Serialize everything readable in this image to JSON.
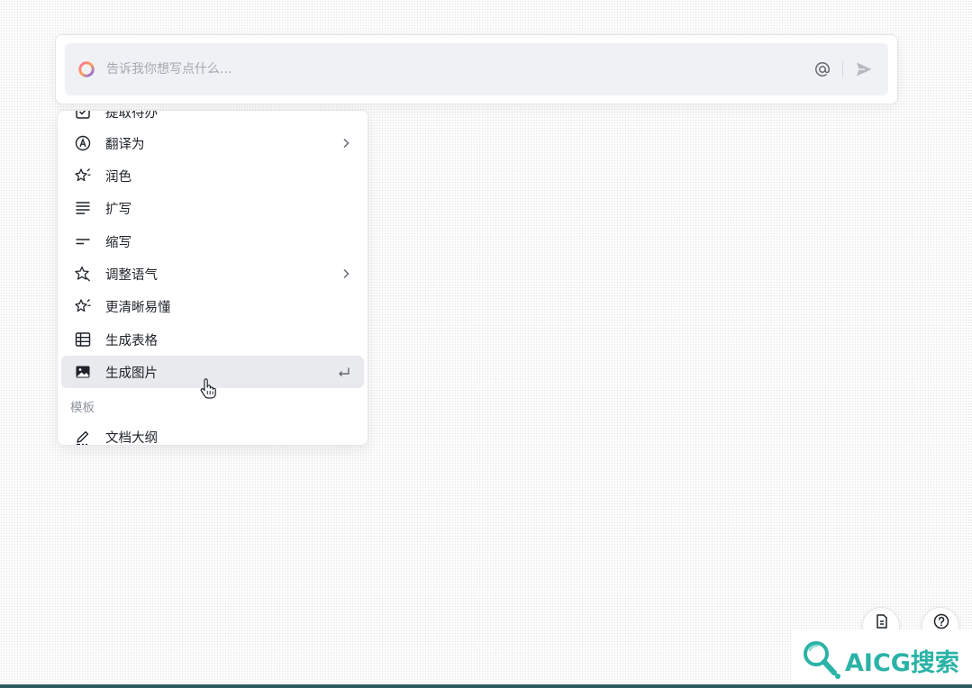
{
  "prompt": {
    "placeholder": "告诉我你想写点什么..."
  },
  "menu": {
    "items": [
      {
        "label": "提取待办",
        "icon": "checkbox-icon"
      },
      {
        "label": "翻译为",
        "icon": "translate-icon",
        "submenu": true
      },
      {
        "label": "润色",
        "icon": "sparkle-icon"
      },
      {
        "label": "扩写",
        "icon": "expand-lines-icon"
      },
      {
        "label": "缩写",
        "icon": "shorten-lines-icon"
      },
      {
        "label": "调整语气",
        "icon": "tone-star-icon",
        "submenu": true
      },
      {
        "label": "更清晰易懂",
        "icon": "clarify-sparkle-icon"
      },
      {
        "label": "生成表格",
        "icon": "table-icon"
      },
      {
        "label": "生成图片",
        "icon": "image-icon",
        "active": true,
        "shortcut": "enter-key-icon"
      }
    ],
    "section_label": "模板",
    "template_items": [
      {
        "label": "文档大纲",
        "icon": "pen-icon"
      }
    ]
  },
  "floating_buttons": [
    {
      "icon": "document-icon"
    },
    {
      "icon": "help-icon"
    }
  ],
  "watermark": {
    "text": "AICG搜索"
  },
  "colors": {
    "accent_gradient_start": "#ff6fa4",
    "accent_gradient_end": "#7a5cff",
    "active_row": "#e9eaed",
    "watermark": "#2ab3a6"
  }
}
